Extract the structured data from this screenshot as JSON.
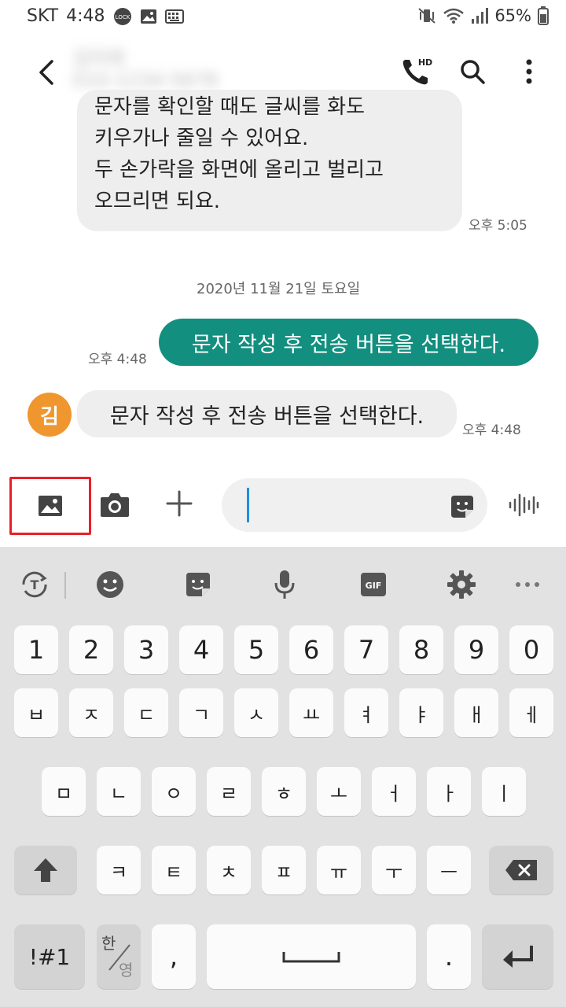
{
  "status": {
    "carrier": "SKT",
    "time": "4:48",
    "battery": "65%"
  },
  "header": {
    "contact_name": "김미래\n010-1234-5678"
  },
  "messages": {
    "first_in_text": "문자를 확인할 때도 글씨를 화도\n키우가나 줄일 수 있어요.\n두 손가락을 화면에 올리고 벌리고\n오므리면 되요.",
    "first_in_time": "오후 5:05",
    "date_separator": "2020년 11월 21일 토요일",
    "out_text": "문자 작성 후 전송 버튼을 선택한다.",
    "out_time": "오후 4:48",
    "avatar_letter": "김",
    "in_text": "문자 작성 후 전송 버튼을 선택한다.",
    "in_time": "오후 4:48"
  },
  "composer": {
    "input_value": "",
    "input_placeholder": ""
  },
  "keyboard": {
    "row_numbers": [
      "1",
      "2",
      "3",
      "4",
      "5",
      "6",
      "7",
      "8",
      "9",
      "0"
    ],
    "row1": [
      "ㅂ",
      "ㅈ",
      "ㄷ",
      "ㄱ",
      "ㅅ",
      "ㅛ",
      "ㅕ",
      "ㅑ",
      "ㅐ",
      "ㅔ"
    ],
    "row2": [
      "ㅁ",
      "ㄴ",
      "ㅇ",
      "ㄹ",
      "ㅎ",
      "ㅗ",
      "ㅓ",
      "ㅏ",
      "ㅣ"
    ],
    "row3": [
      "ㅋ",
      "ㅌ",
      "ㅊ",
      "ㅍ",
      "ㅠ",
      "ㅜ",
      "ㅡ"
    ],
    "symbols_label": "!#1",
    "lang_top": "한",
    "lang_bottom": "영",
    "comma": ",",
    "period": "."
  },
  "colors": {
    "accent_out": "#128f7f",
    "avatar_bg": "#f0962e",
    "highlight_red": "#e8202a",
    "caret": "#1f8fe0"
  }
}
